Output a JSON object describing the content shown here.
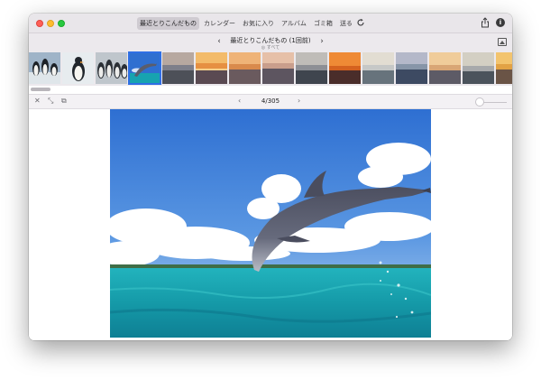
{
  "window": {
    "tabs": [
      {
        "label": "最近とりこんだもの",
        "active": true
      },
      {
        "label": "カレンダー",
        "active": false
      },
      {
        "label": "お気に入り",
        "active": false
      },
      {
        "label": "アルバム",
        "active": false
      },
      {
        "label": "ゴミ箱",
        "active": false
      },
      {
        "label": "送る",
        "active": false
      }
    ],
    "icons": {
      "refresh": "refresh-icon",
      "share": "share-icon",
      "info": "info-icon"
    }
  },
  "album": {
    "title": "最近とりこんだもの (1回前)",
    "subtitle": "◎ すべて",
    "prev": "‹",
    "next": "›"
  },
  "thumbnails": [
    {
      "kind": "penguins-group",
      "selected": false
    },
    {
      "kind": "penguin-single",
      "selected": false
    },
    {
      "kind": "penguins-crowd",
      "selected": false
    },
    {
      "kind": "dolphin",
      "selected": true
    },
    {
      "kind": "sunset-sea-dark",
      "selected": false
    },
    {
      "kind": "sunset-orange",
      "selected": false
    },
    {
      "kind": "sunset-orange",
      "selected": false
    },
    {
      "kind": "sunset-pink",
      "selected": false
    },
    {
      "kind": "sea-grey",
      "selected": false
    },
    {
      "kind": "sunset-red",
      "selected": false
    },
    {
      "kind": "sea-pale",
      "selected": false
    },
    {
      "kind": "sea-blue",
      "selected": false
    },
    {
      "kind": "sunset-glow",
      "selected": false
    },
    {
      "kind": "sea-horizon",
      "selected": false
    },
    {
      "kind": "sunset-gold",
      "selected": false
    }
  ],
  "toolbar": {
    "close": "✕",
    "expand": "⤡",
    "slideshow": "⧉",
    "prev": "‹",
    "next": "›",
    "counter": "4/305"
  },
  "viewer": {
    "photo": "dolphin-jumping-over-sea"
  },
  "colors": {
    "accent": "#2f6fe4",
    "titlebar": "#e9e6ea",
    "sky": "#3e7fd6",
    "sea": "#1ba7b5"
  }
}
